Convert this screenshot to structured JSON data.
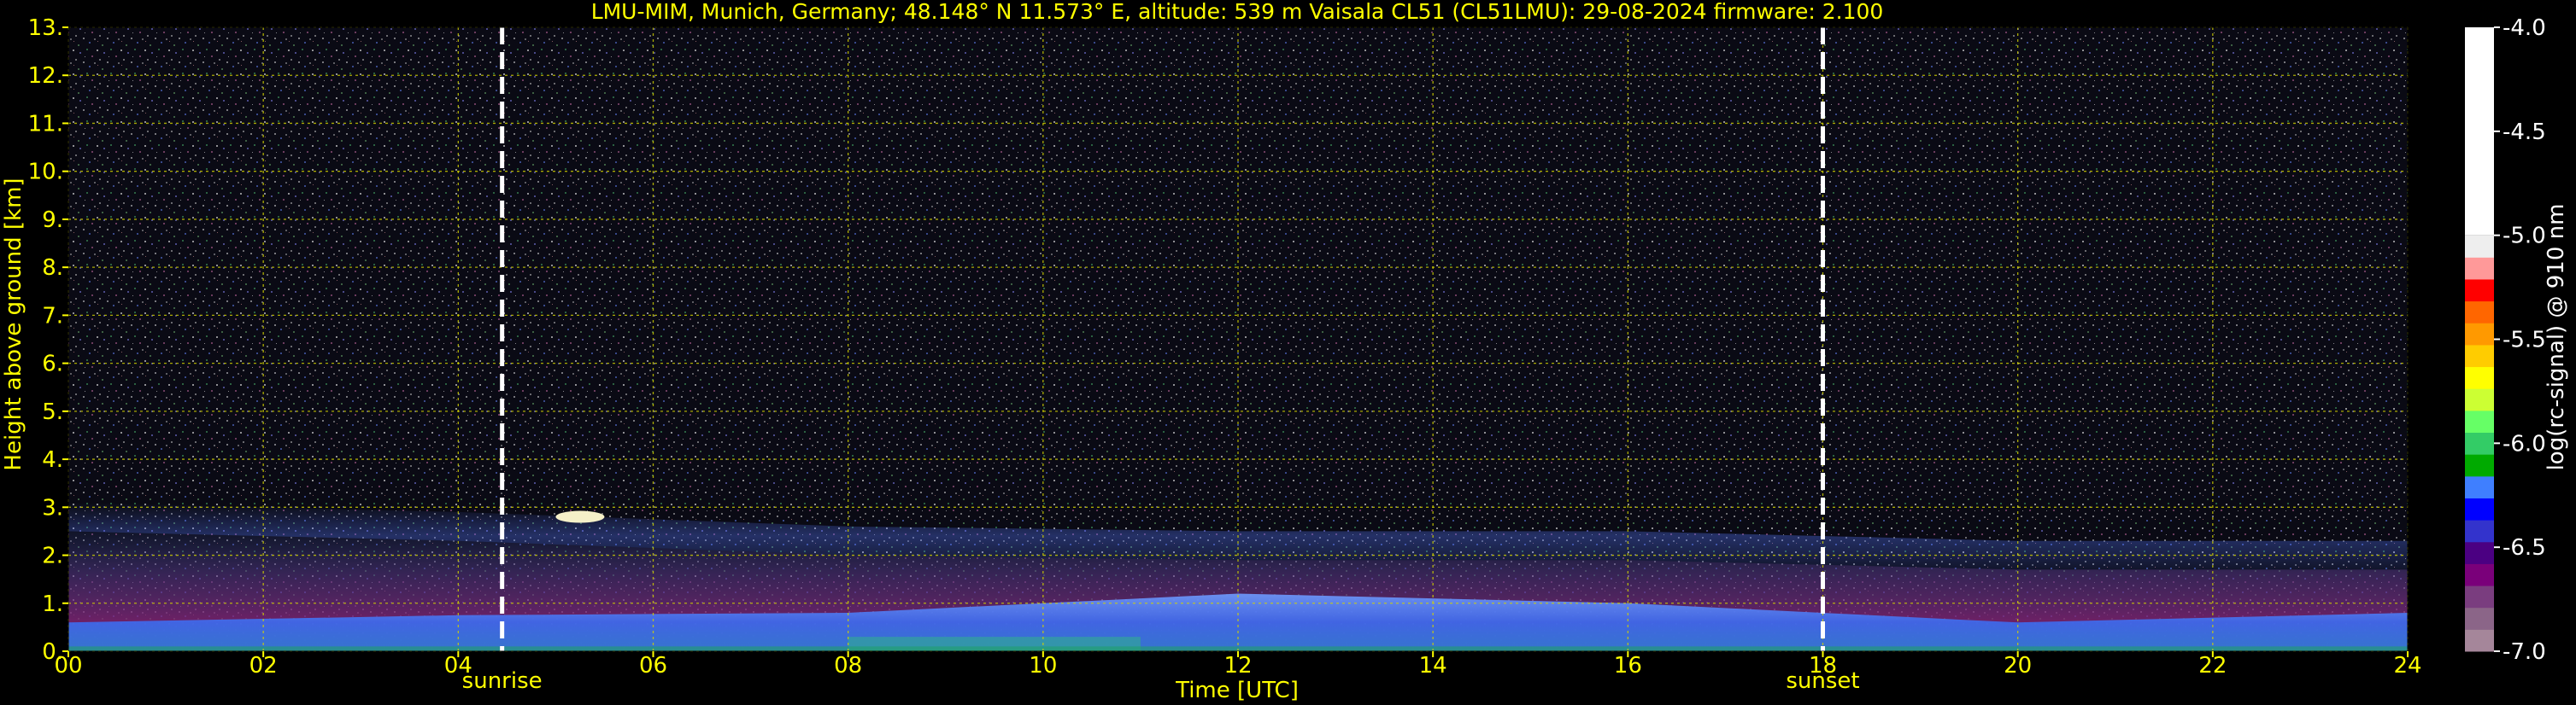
{
  "chart_data": {
    "type": "heatmap",
    "title": "LMU-MIM, Munich, Germany; 48.148° N 11.573° E, altitude: 539 m    Vaisala CL51 (CL51LMU): 29-08-2024    firmware: 2.100",
    "xlabel": "Time [UTC]",
    "ylabel": "Height above ground [km]",
    "xlim": [
      0,
      24
    ],
    "ylim": [
      0,
      13
    ],
    "x_ticks": [
      "00",
      "02",
      "04",
      "06",
      "08",
      "10",
      "12",
      "14",
      "16",
      "18",
      "20",
      "22",
      "24"
    ],
    "y_ticks": [
      "0.",
      "1.",
      "2.",
      "3.",
      "4.",
      "5.",
      "6.",
      "7.",
      "8.",
      "9.",
      "10.",
      "11.",
      "12.",
      "13."
    ],
    "grid": true,
    "markers": [
      {
        "label": "sunrise",
        "x": 4.45
      },
      {
        "label": "sunset",
        "x": 18.0
      }
    ],
    "colorbar": {
      "label": "log(rc-signal) @ 910 nm",
      "range": [
        -7.0,
        -4.0
      ],
      "ticks": [
        "-4.0",
        "-4.5",
        "-5.0",
        "-5.5",
        "-6.0",
        "-6.5",
        "-7.0"
      ]
    },
    "features": {
      "boundary_layer_top_km": [
        {
          "x": 0,
          "y": 0.6
        },
        {
          "x": 4,
          "y": 0.75
        },
        {
          "x": 8,
          "y": 0.8
        },
        {
          "x": 12,
          "y": 1.2
        },
        {
          "x": 16,
          "y": 1.0
        },
        {
          "x": 20,
          "y": 0.6
        },
        {
          "x": 24,
          "y": 0.8
        }
      ],
      "residual_layer_top_km": [
        {
          "x": 0,
          "y": 2.5
        },
        {
          "x": 4,
          "y": 2.3
        },
        {
          "x": 8,
          "y": 2.0
        },
        {
          "x": 12,
          "y": 1.9
        },
        {
          "x": 16,
          "y": 1.9
        },
        {
          "x": 20,
          "y": 1.7
        },
        {
          "x": 24,
          "y": 1.7
        }
      ],
      "cloud": {
        "x_start": 5.0,
        "x_end": 5.5,
        "y_km": 2.8
      }
    },
    "colors": {
      "text": "#ffff00",
      "grid": "#d4d400",
      "marker": "#ffffff",
      "colorbar": [
        "#a5869a",
        "#8b6588",
        "#7a3d7f",
        "#7a007a",
        "#4b0082",
        "#3333cc",
        "#0000ff",
        "#3f7fff",
        "#00aa00",
        "#33cc66",
        "#66ff66",
        "#ccff33",
        "#ffff00",
        "#ffcc00",
        "#ff9900",
        "#ff6600",
        "#ff0000",
        "#ff9999",
        "#eeeeee",
        "#ffffff"
      ]
    }
  }
}
